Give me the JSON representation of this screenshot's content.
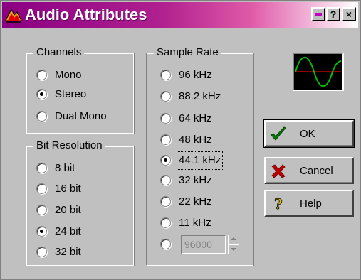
{
  "window": {
    "title": "Audio Attributes",
    "title_buttons": {
      "minimize": "",
      "help": "?",
      "close": "×"
    }
  },
  "channels": {
    "label": "Channels",
    "options": [
      {
        "label": "Mono",
        "checked": false
      },
      {
        "label": "Stereo",
        "checked": true
      },
      {
        "label": "Dual Mono",
        "checked": false
      }
    ]
  },
  "bit_resolution": {
    "label": "Bit Resolution",
    "options": [
      {
        "label": "8 bit",
        "checked": false
      },
      {
        "label": "16 bit",
        "checked": false
      },
      {
        "label": "20 bit",
        "checked": false
      },
      {
        "label": "24 bit",
        "checked": true
      },
      {
        "label": "32 bit",
        "checked": false
      }
    ]
  },
  "sample_rate": {
    "label": "Sample Rate",
    "options": [
      {
        "label": "96 kHz",
        "checked": false
      },
      {
        "label": "88.2 kHz",
        "checked": false
      },
      {
        "label": "64 kHz",
        "checked": false
      },
      {
        "label": "48 kHz",
        "checked": false
      },
      {
        "label": "44.1 kHz",
        "checked": true
      },
      {
        "label": "32 kHz",
        "checked": false
      },
      {
        "label": "22 kHz",
        "checked": false
      },
      {
        "label": "11 kHz",
        "checked": false
      }
    ],
    "custom": {
      "checked": false,
      "value": "96000"
    }
  },
  "buttons": {
    "ok": "OK",
    "cancel": "Cancel",
    "help": "Help"
  },
  "colors": {
    "title_gradient_start": "#8a0082",
    "face": "#c0c0c0",
    "scope_wave": "#00c000",
    "scope_axis": "#c00000"
  },
  "icons": {
    "app": "audio-attributes-icon",
    "scope": "waveform-scope-icon",
    "ok": "checkmark-icon",
    "cancel": "x-mark-icon",
    "help": "question-mark-icon"
  }
}
